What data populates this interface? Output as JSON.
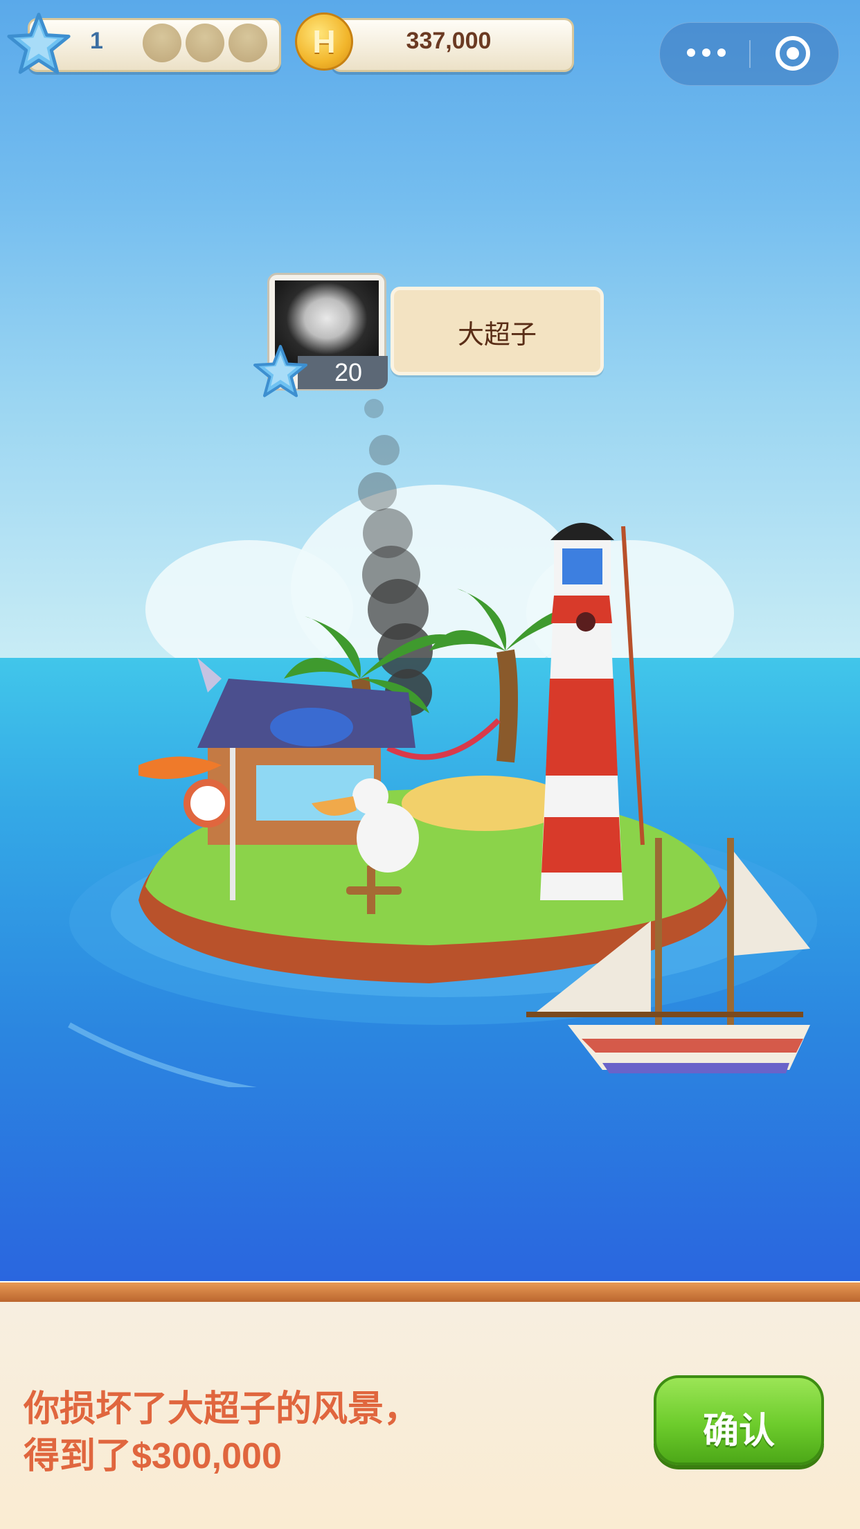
{
  "hud": {
    "level": "1",
    "shell_slots": [
      "empty-shell",
      "empty-shell",
      "empty-shell"
    ],
    "coin_symbol": "H",
    "coins": "337,000",
    "capsule_icons": [
      "more-dots-icon",
      "target-ring-icon"
    ]
  },
  "player": {
    "name": "大超子",
    "level": "20"
  },
  "dialog": {
    "line1": "你损坏了大超子的风景，",
    "line2": "得到了$300,000",
    "confirm_label": "确认"
  },
  "colors": {
    "accent_orange": "#e0663e",
    "confirm_green": "#6dcc2c",
    "sea_blue": "#2b86e0",
    "sky_blue": "#74bdef"
  }
}
